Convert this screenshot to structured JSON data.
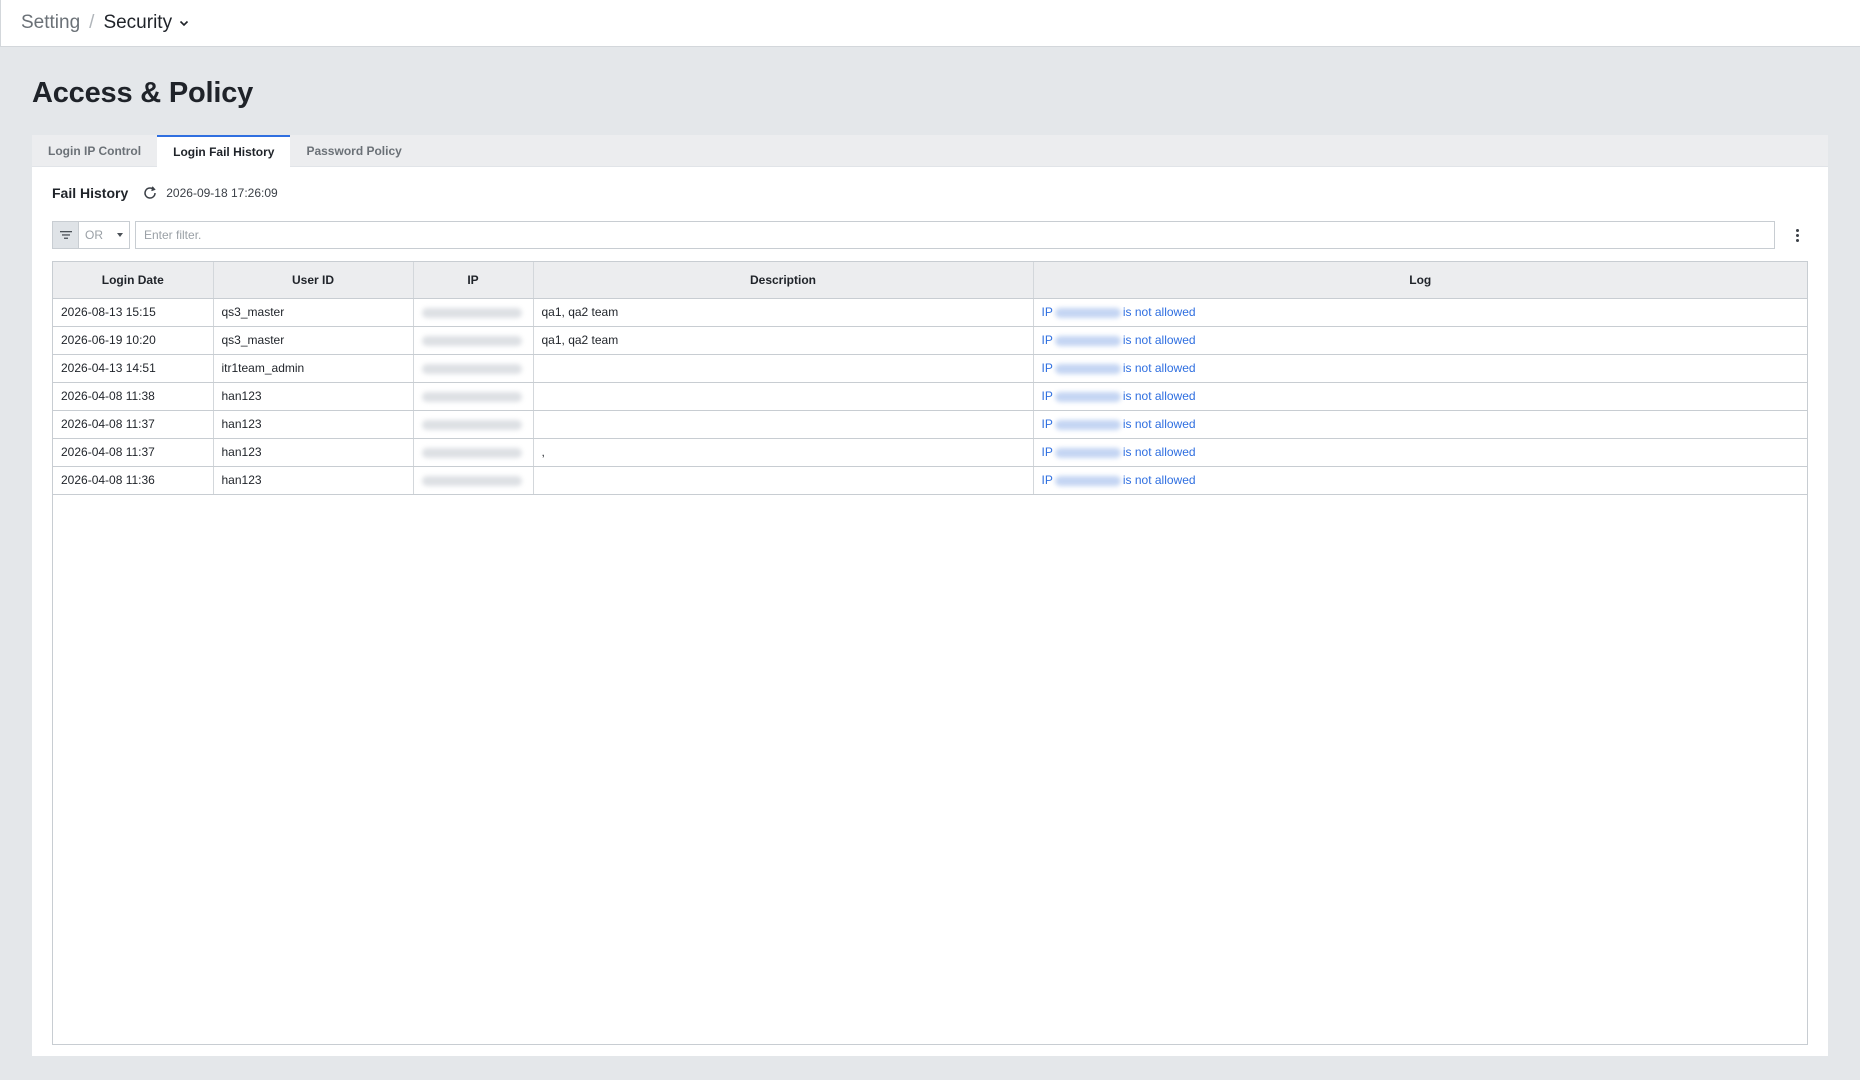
{
  "breadcrumb": {
    "root": "Setting",
    "separator": "/",
    "current": "Security"
  },
  "page": {
    "title": "Access & Policy"
  },
  "tabs": [
    {
      "label": "Login IP Control",
      "active": false
    },
    {
      "label": "Login Fail History",
      "active": true
    },
    {
      "label": "Password Policy",
      "active": false
    }
  ],
  "section": {
    "title": "Fail History",
    "timestamp": "2026-09-18 17:26:09"
  },
  "filter": {
    "operator": "OR",
    "placeholder": "Enter filter.",
    "value": ""
  },
  "table": {
    "columns": [
      "Login Date",
      "User ID",
      "IP",
      "Description",
      "Log"
    ],
    "log_prefix": "IP",
    "log_suffix": "is not allowed",
    "rows": [
      {
        "date": "2026-08-13 15:15",
        "user": "qs3_master",
        "description": "qa1, qa2 team"
      },
      {
        "date": "2026-06-19 10:20",
        "user": "qs3_master",
        "description": "qa1, qa2 team"
      },
      {
        "date": "2026-04-13 14:51",
        "user": "itr1team_admin",
        "description": ""
      },
      {
        "date": "2026-04-08 11:38",
        "user": "han123",
        "description": ""
      },
      {
        "date": "2026-04-08 11:37",
        "user": "han123",
        "description": ""
      },
      {
        "date": "2026-04-08 11:37",
        "user": "han123",
        "description": ","
      },
      {
        "date": "2026-04-08 11:36",
        "user": "han123",
        "description": ""
      }
    ]
  },
  "colors": {
    "accent": "#2f6fe0",
    "background": "#e4e7ea",
    "header_bg": "#ecedef"
  }
}
